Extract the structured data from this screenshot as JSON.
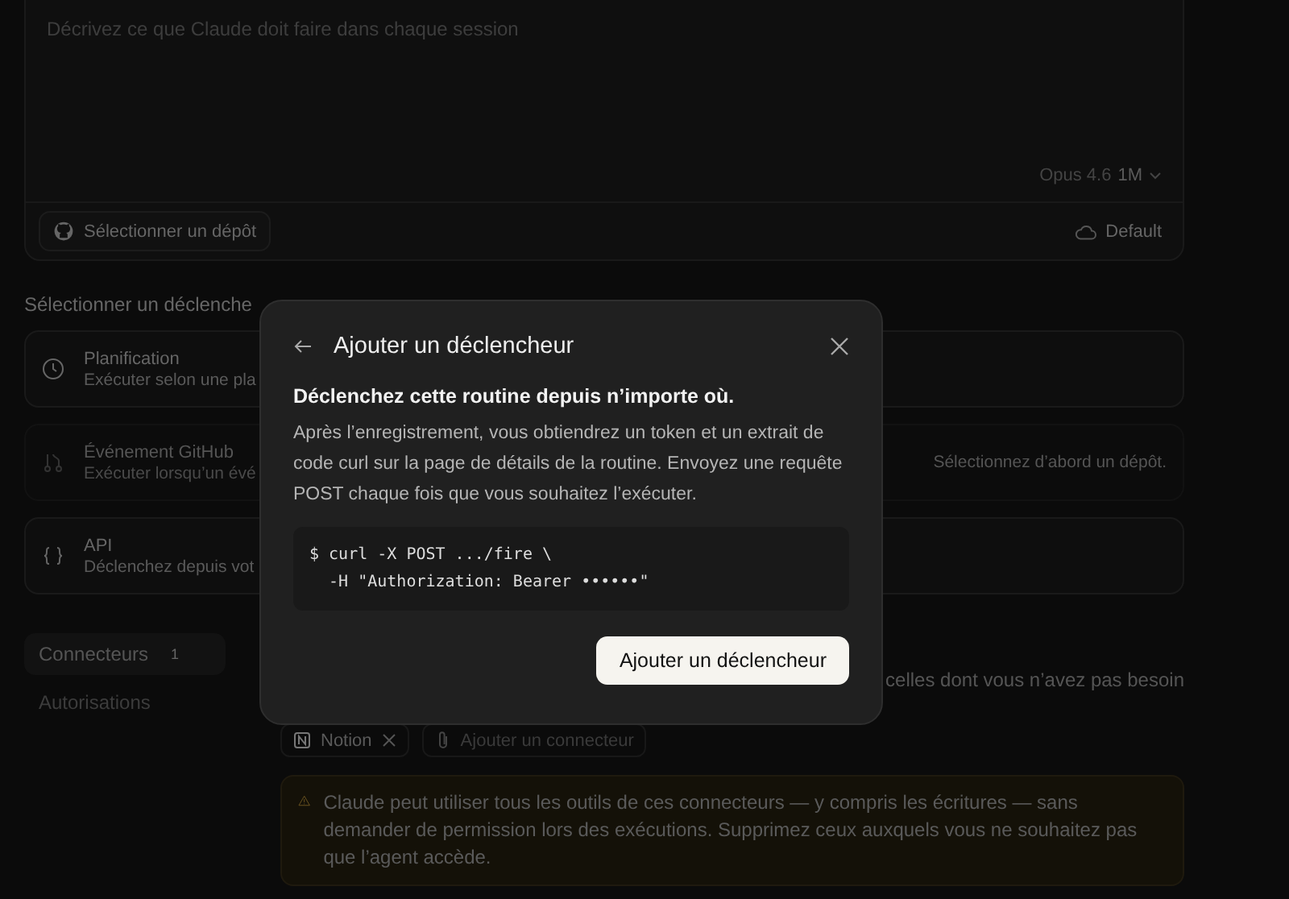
{
  "prompt": {
    "placeholder": "Décrivez ce que Claude doit faire dans chaque session",
    "model": "Opus 4.6",
    "model_variant": "1M",
    "repo_button": "Sélectionner un dépôt",
    "environment": "Default"
  },
  "triggers": {
    "heading": "Sélectionner un déclenche",
    "items": [
      {
        "kind": "schedule",
        "title": "Planification",
        "description": "Exécuter selon une pla",
        "disabled": false
      },
      {
        "kind": "github",
        "title": "Événement GitHub",
        "description": "Exécuter lorsqu’un évé",
        "disabled": true,
        "note": "Sélectionnez d’abord un dépôt."
      },
      {
        "kind": "api",
        "title": "API",
        "description": "Déclenchez depuis vot",
        "disabled": false
      }
    ]
  },
  "nav": [
    {
      "label": "Connecteurs",
      "count": "1",
      "selected": true
    },
    {
      "label": "Autorisations",
      "selected": false
    }
  ],
  "connectors": {
    "intro_tail": "celles dont vous n’avez pas besoin",
    "chips": [
      {
        "label": "Notion"
      }
    ],
    "add_label": "Ajouter un connecteur",
    "warning": "Claude peut utiliser tous les outils de ces connecteurs — y compris les écritures — sans demander de permission lors des exécutions. Supprimez ceux auxquels vous ne souhaitez pas que l’agent accède."
  },
  "dialog": {
    "title": "Ajouter un déclencheur",
    "heading": "Déclenchez cette routine depuis n’importe où.",
    "body": "Après l’enregistrement, vous obtiendrez un token et un extrait de code curl sur la page de détails de la routine. Envoyez une requête POST chaque fois que vous souhaitez l’exécuter.",
    "code": [
      "$ curl -X POST .../fire \\",
      "  -H \"Authorization: Bearer ••••••\""
    ],
    "button": "Ajouter un déclencheur"
  }
}
